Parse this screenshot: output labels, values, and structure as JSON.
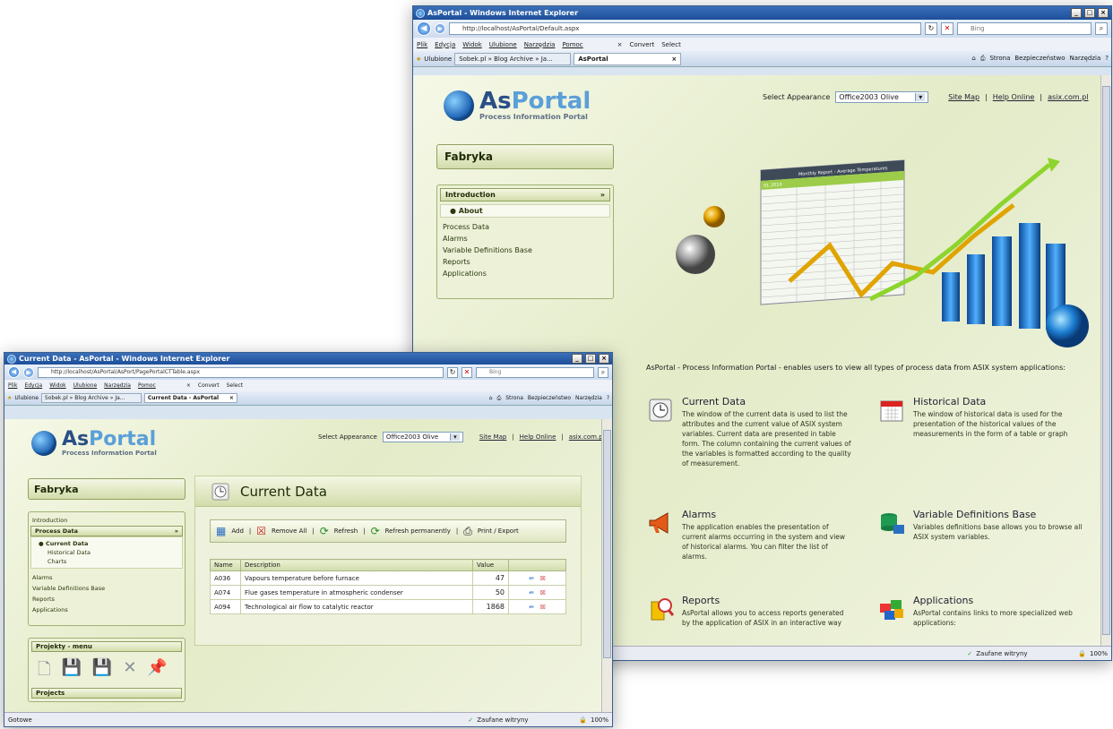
{
  "w1": {
    "title": "AsPortal - Windows Internet Explorer",
    "url": "http://localhost/AsPortal/Default.aspx",
    "search": "Bing",
    "menu": [
      "Plik",
      "Edycja",
      "Widok",
      "Ulubione",
      "Narzędzia",
      "Pomoc"
    ],
    "convert": "Convert",
    "select_tool": "Select",
    "fav": "Ulubione",
    "tab1": "Sobek.pl » Blog Archive » Ja...",
    "tab2": "AsPortal",
    "tools": [
      "Strona",
      "Bezpieczeństwo",
      "Narzędzia"
    ],
    "logo_as": "As",
    "logo_portal": "Portal",
    "logo_sub": "Process Information Portal",
    "appearance_label": "Select Appearance",
    "appearance_value": "Office2003 Olive",
    "links": [
      "Site Map",
      "Help Online",
      "asix.com.pl"
    ],
    "section": "Fabryka",
    "nav_header": "Introduction",
    "nav_active": "About",
    "nav_items": [
      "Process Data",
      "Alarms",
      "Variable Definitions Base",
      "Reports",
      "Applications"
    ],
    "report_title": "Monthly Report - Average Temperatures",
    "report_month": "01.2010",
    "intro": "AsPortal - Process Information Portal - enables users to view all types of process data from ASIX system applications:",
    "features": [
      {
        "title": "Current Data",
        "desc": "The window of the current data is used to list the attributes and the current value of ASIX system variables. Current data are presented in table form. The column containing the current values of the variables is formatted according to the quality of measurement."
      },
      {
        "title": "Historical Data",
        "desc": "The window of historical data is used for the presentation of the historical values of the measurements in the form of a table or graph"
      },
      {
        "title": "Alarms",
        "desc": "The application enables the presentation of current alarms occurring in the system and view of historical alarms. You can filter the list of alarms."
      },
      {
        "title": "Variable Definitions Base",
        "desc": "Variables definitions base allows you to browse all ASIX system variables."
      },
      {
        "title": "Reports",
        "desc": "AsPortal allows you to access reports generated by the application of ASIX in an interactive way"
      },
      {
        "title": "Applications",
        "desc": "AsPortal contains links to more specialized web applications:"
      }
    ],
    "status_zone": "Zaufane witryny",
    "zoom": "100%"
  },
  "w2": {
    "title": "Current Data - AsPortal - Windows Internet Explorer",
    "url": "http://localhost/AsPortal/AsPort/PagePortalCTTable.aspx",
    "search": "Bing",
    "menu": [
      "Plik",
      "Edycja",
      "Widok",
      "Ulubione",
      "Narzędzia",
      "Pomoc"
    ],
    "convert": "Convert",
    "select_tool": "Select",
    "fav": "Ulubione",
    "tab1": "Sobek.pl » Blog Archive » Ja...",
    "tab2": "Current Data - AsPortal",
    "tools": [
      "Strona",
      "Bezpieczeństwo",
      "Narzędzia"
    ],
    "logo_as": "As",
    "logo_portal": "Portal",
    "logo_sub": "Process Information Portal",
    "appearance_label": "Select Appearance",
    "appearance_value": "Office2003 Olive",
    "links": [
      "Site Map",
      "Help Online",
      "asix.com.pl"
    ],
    "section": "Fabryka",
    "nav_intro": "Introduction",
    "nav_header": "Process Data",
    "nav_sub_active": "Current Data",
    "nav_sub": [
      "Historical Data",
      "Charts"
    ],
    "nav_items": [
      "Alarms",
      "Variable Definitions Base",
      "Reports",
      "Applications"
    ],
    "proj_menu": "Projekty - menu",
    "projects": "Projects",
    "page_title": "Current Data",
    "toolbar": [
      "Add",
      "Remove All",
      "Refresh",
      "Refresh permanently",
      "Print / Export"
    ],
    "table_headers": [
      "Name",
      "Description",
      "Value"
    ],
    "rows": [
      {
        "name": "A036",
        "desc": "Vapours temperature before furnace",
        "value": "47"
      },
      {
        "name": "A074",
        "desc": "Flue gases temperature in atmospheric condenser",
        "value": "50"
      },
      {
        "name": "A094",
        "desc": "Technological air flow to catalytic reactor",
        "value": "1868"
      }
    ],
    "status_left": "Gotowe",
    "status_zone": "Zaufane witryny",
    "zoom": "100%"
  }
}
